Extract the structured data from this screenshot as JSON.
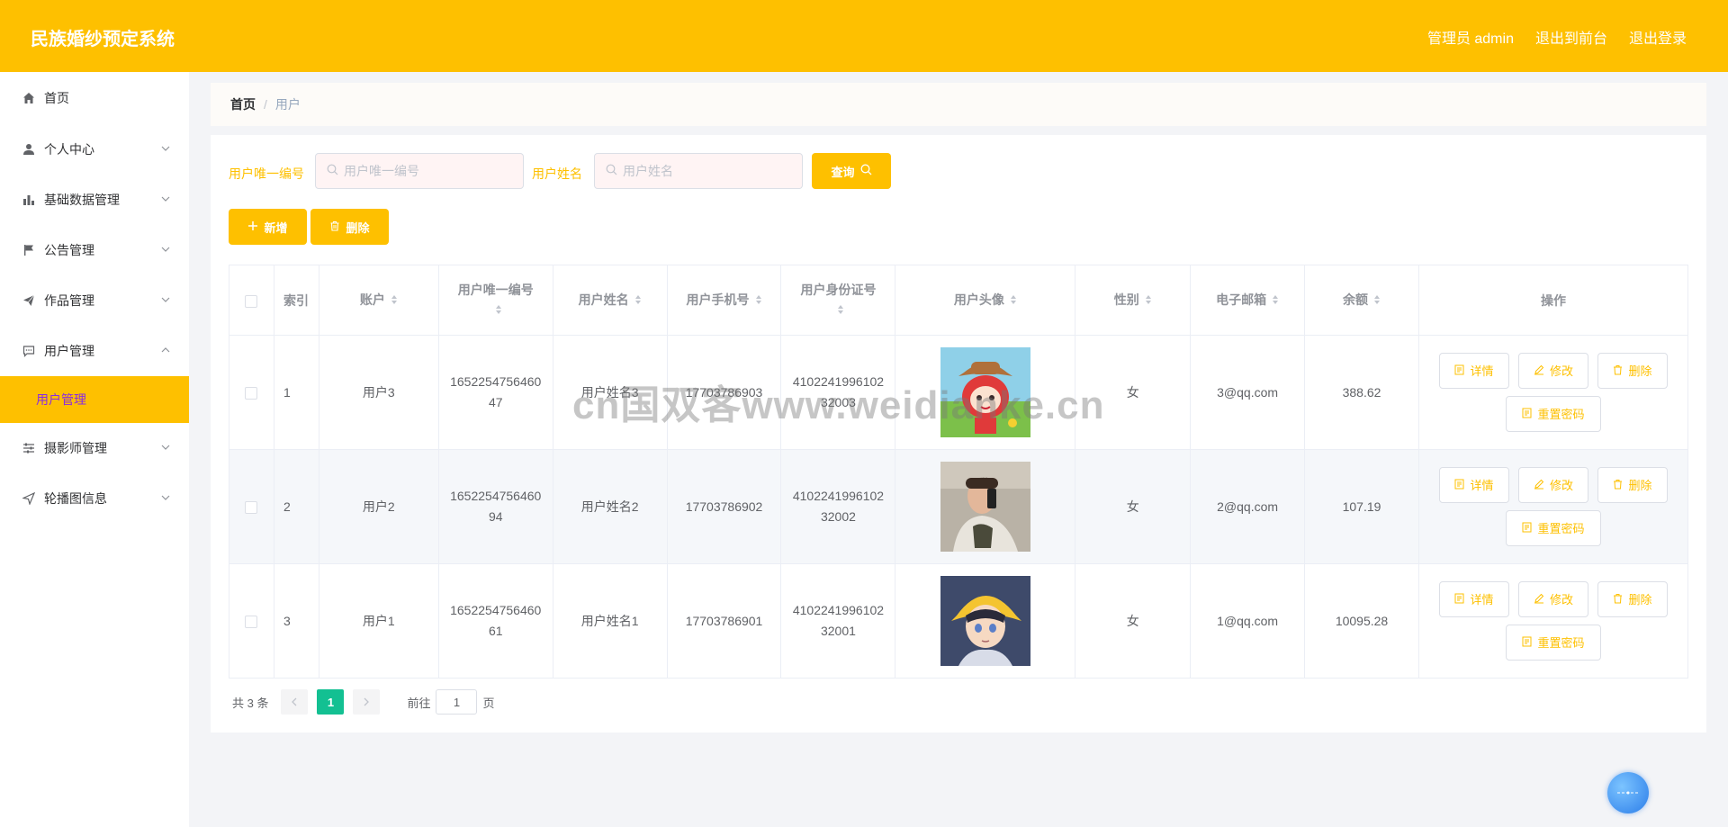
{
  "header": {
    "title": "民族婚纱预定系统",
    "admin_label": "管理员 admin",
    "to_front_label": "退出到前台",
    "logout_label": "退出登录"
  },
  "sidebar": {
    "items": [
      {
        "label": "首页",
        "icon": "home-icon"
      },
      {
        "label": "个人中心",
        "icon": "user-icon"
      },
      {
        "label": "基础数据管理",
        "icon": "bar-chart-icon"
      },
      {
        "label": "公告管理",
        "icon": "flag-icon"
      },
      {
        "label": "作品管理",
        "icon": "paper-plane-icon"
      },
      {
        "label": "用户管理",
        "icon": "chat-icon"
      },
      {
        "label": "摄影师管理",
        "icon": "sliders-icon"
      },
      {
        "label": "轮播图信息",
        "icon": "send-icon"
      }
    ],
    "active_sub": "用户管理"
  },
  "breadcrumb": {
    "home": "首页",
    "separator": "/",
    "current": "用户"
  },
  "search": {
    "uid_label": "用户唯一编号",
    "uid_placeholder": "用户唯一编号",
    "name_label": "用户姓名",
    "name_placeholder": "用户姓名",
    "query_label": "查询"
  },
  "actions": {
    "add_label": "新增",
    "delete_label": "删除"
  },
  "table": {
    "headers": {
      "index": "索引",
      "account": "账户",
      "uid": "用户唯一编号",
      "name": "用户姓名",
      "phone": "用户手机号",
      "idcard": "用户身份证号",
      "avatar": "用户头像",
      "gender": "性别",
      "email": "电子邮箱",
      "balance": "余额",
      "ops": "操作"
    },
    "op_labels": {
      "detail": "详情",
      "edit": "修改",
      "delete": "删除",
      "reset": "重置密码"
    },
    "rows": [
      {
        "index": "1",
        "account": "用户3",
        "uid_a": "1652254756460",
        "uid_b": "47",
        "name": "用户姓名3",
        "phone": "17703786903",
        "id_a": "4102241996102",
        "id_b": "32003",
        "gender": "女",
        "email": "3@qq.com",
        "balance": "388.62"
      },
      {
        "index": "2",
        "account": "用户2",
        "uid_a": "1652254756460",
        "uid_b": "94",
        "name": "用户姓名2",
        "phone": "17703786902",
        "id_a": "4102241996102",
        "id_b": "32002",
        "gender": "女",
        "email": "2@qq.com",
        "balance": "107.19"
      },
      {
        "index": "3",
        "account": "用户1",
        "uid_a": "1652254756460",
        "uid_b": "61",
        "name": "用户姓名1",
        "phone": "17703786901",
        "id_a": "4102241996102",
        "id_b": "32001",
        "gender": "女",
        "email": "1@qq.com",
        "balance": "10095.28"
      }
    ]
  },
  "pager": {
    "total": "共 3 条",
    "current": "1",
    "goto": "前往",
    "page_value": "1",
    "page_unit": "页"
  },
  "watermark": "cn国双客www.weidianke.cn",
  "colors": {
    "brand": "#fec000",
    "active_text": "#8a2be2",
    "page_active": "#13c092"
  }
}
